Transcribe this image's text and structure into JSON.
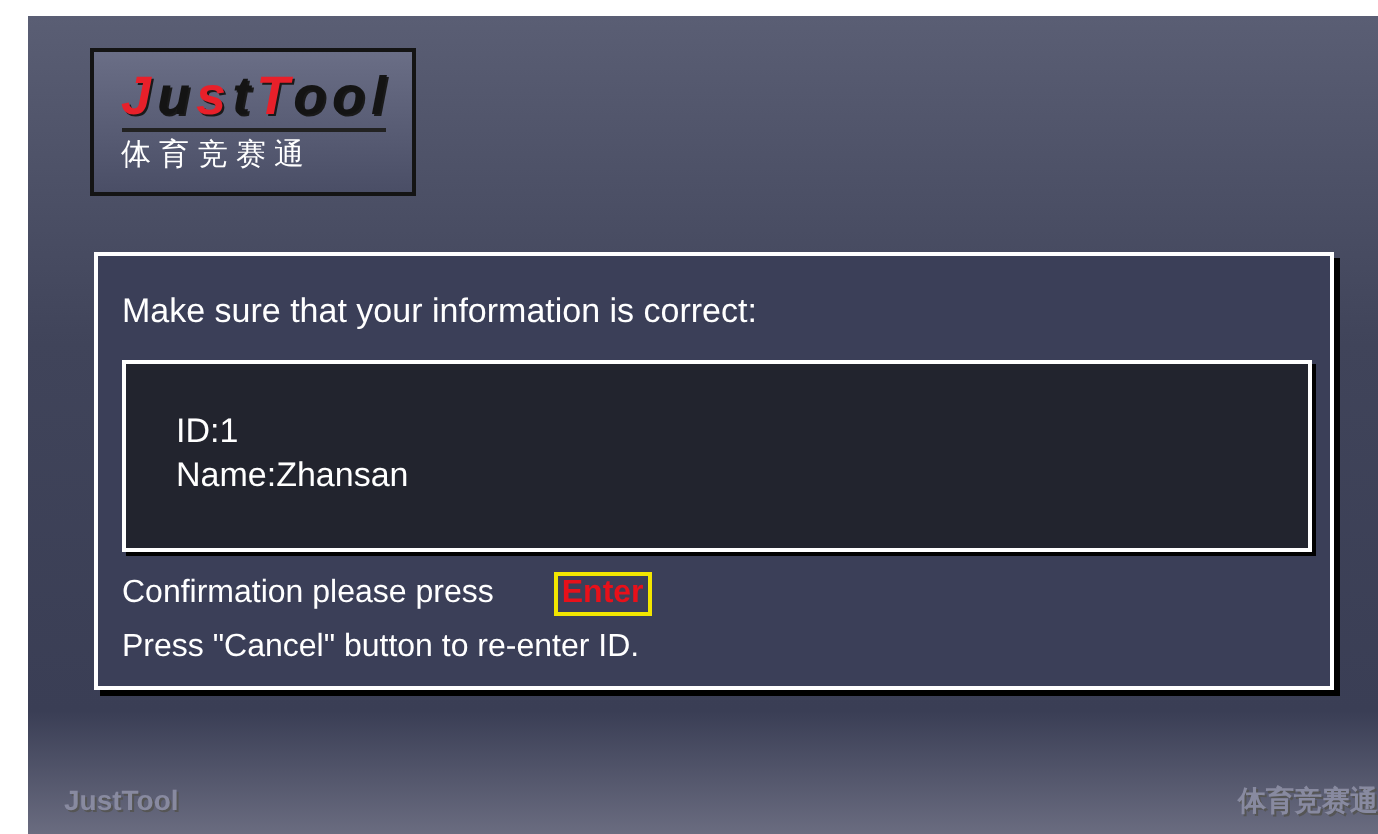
{
  "logo": {
    "parts": [
      {
        "text": "J",
        "color": "#e8202a"
      },
      {
        "text": "u",
        "color": "#141414"
      },
      {
        "text": "s",
        "color": "#e8202a"
      },
      {
        "text": "t",
        "color": "#141414"
      },
      {
        "text": "T",
        "color": "#e8202a"
      },
      {
        "text": "ool",
        "color": "#141414"
      }
    ],
    "subtitle": "体 育 竞 赛 通"
  },
  "dialog": {
    "prompt": "Make sure that your information is correct:",
    "info": [
      "ID:1",
      "Name:Zhansan"
    ],
    "confirm_text": "Confirmation please press",
    "confirm_key": "Enter",
    "cancel_text": "Press \"Cancel\" button to re-enter ID."
  },
  "footer": {
    "left": "JustTool",
    "right": "体育竞赛通"
  }
}
